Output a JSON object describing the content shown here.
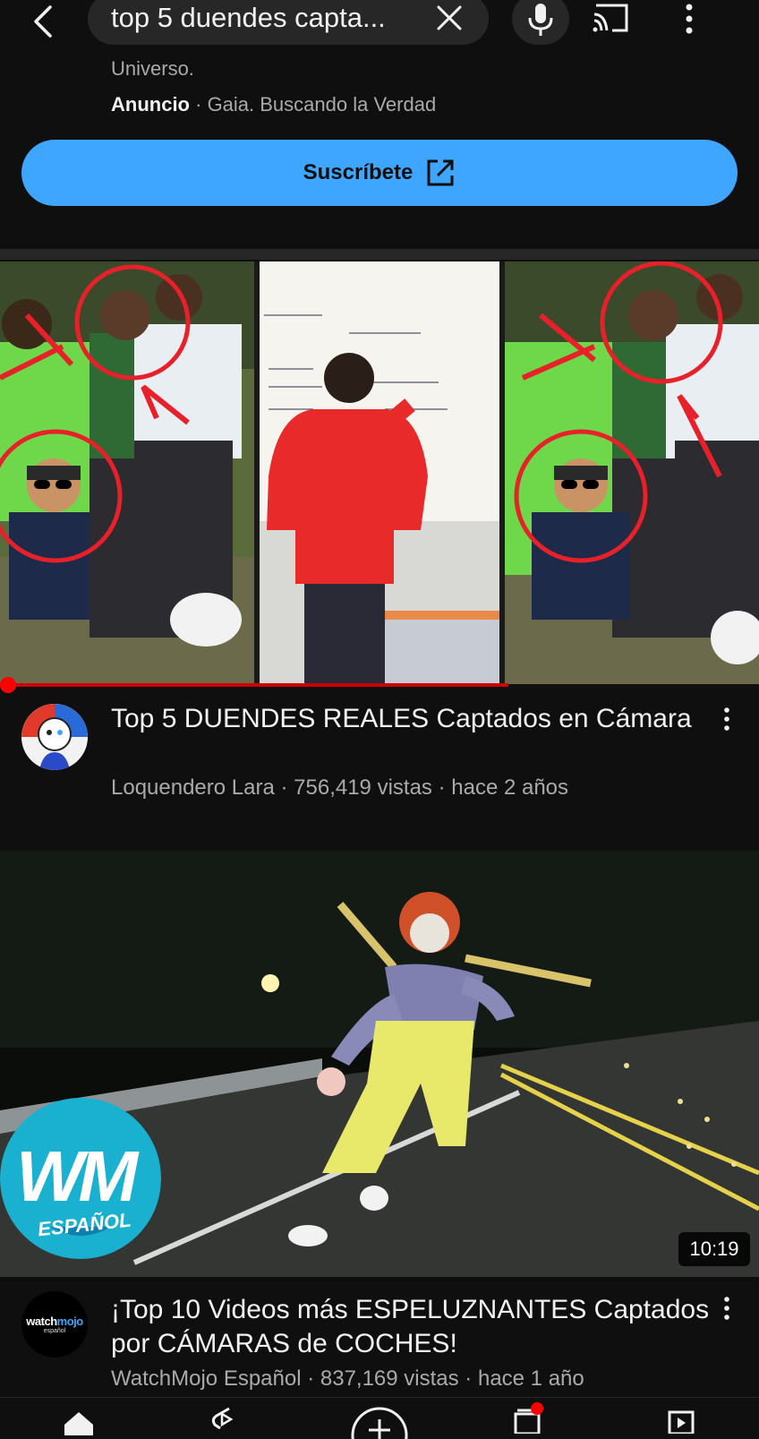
{
  "search": {
    "query": "top 5 duendes capta..."
  },
  "ad": {
    "description": "Universo.",
    "label": "Anuncio",
    "separator": " · ",
    "advertiser": "Gaia. Buscando la Verdad",
    "cta": "Suscríbete"
  },
  "videos": [
    {
      "title": "Top 5 DUENDES REALES Captados en Cámara",
      "meta": "Loquendero Lara · 756,419 vistas · hace 2 años",
      "progress_fraction": 0.67
    },
    {
      "title": "¡Top 10 Videos más ESPELUZNANTES Captados por CÁMARAS de COCHES!",
      "meta": "WatchMojo Español · 837,169 vistas · hace 1 año",
      "duration": "10:19",
      "channel_logo_text_a": "watch",
      "channel_logo_text_b": "mojo",
      "channel_logo_sub": "español",
      "thumb_logo_text": "WM",
      "thumb_logo_sub": "ESPAÑOL"
    }
  ],
  "colors": {
    "accent": "#3ea6ff",
    "background": "#0f0f0f",
    "progress": "#ff0000",
    "secondary_text": "#aaaaaa"
  }
}
